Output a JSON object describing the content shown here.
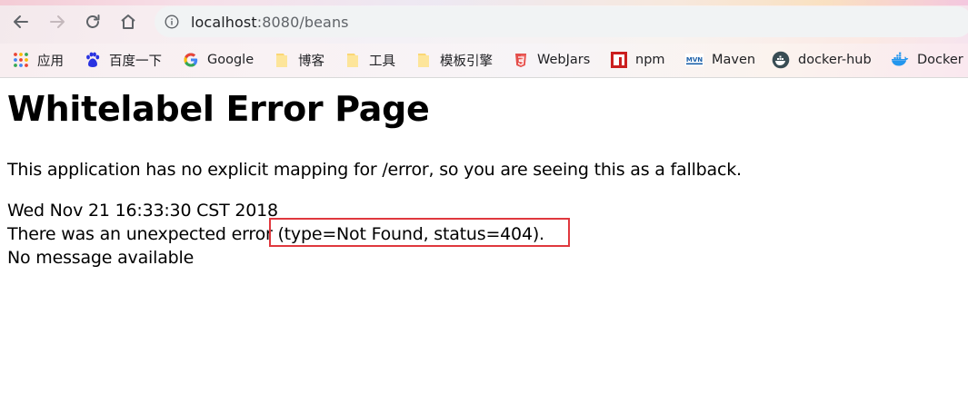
{
  "browser": {
    "url_host": "localhost",
    "url_rest": ":8080/beans"
  },
  "bookmarks": [
    {
      "label": "应用",
      "icon": "apps-grid-icon"
    },
    {
      "label": "百度一下",
      "icon": "baidu-paw-icon"
    },
    {
      "label": "Google",
      "icon": "google-g-icon"
    },
    {
      "label": "博客",
      "icon": "folder-icon"
    },
    {
      "label": "工具",
      "icon": "folder-icon"
    },
    {
      "label": "模板引擎",
      "icon": "folder-icon"
    },
    {
      "label": "WebJars",
      "icon": "webjars-icon"
    },
    {
      "label": "npm",
      "icon": "npm-icon"
    },
    {
      "label": "Maven",
      "icon": "maven-icon"
    },
    {
      "label": "docker-hub",
      "icon": "docker-hub-icon"
    },
    {
      "label": "Docker -",
      "icon": "docker-whale-icon"
    }
  ],
  "page": {
    "title": "Whitelabel Error Page",
    "description": "This application has no explicit mapping for /error, so you are seeing this as a fallback.",
    "timestamp": "Wed Nov 21 16:33:30 CST 2018",
    "error_prefix": "There was an unexpected error ",
    "error_detail": "(type=Not Found, status=404).",
    "message": "No message available"
  },
  "colors": {
    "highlight_border": "#e0383e"
  }
}
